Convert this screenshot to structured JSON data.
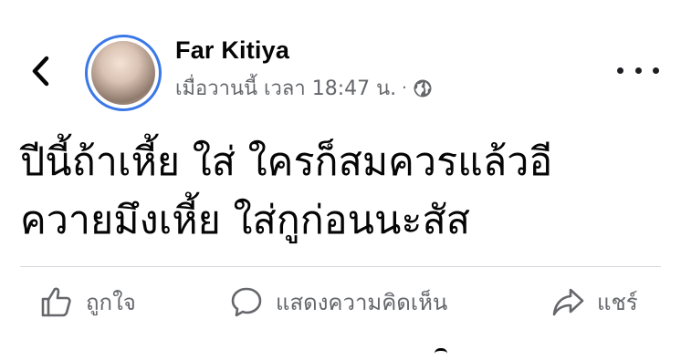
{
  "post": {
    "author": "Far Kitiya",
    "timestamp": "เมื่อวานนี้ เวลา 18:47 น.",
    "separator": "·",
    "privacy_icon": "globe-icon",
    "text_line_1": "ปีนี้ถ้าเหี้ย ใส่ ใครก็สมควรแล้วอี",
    "text_line_2": "ควายมึงเหี้ย ใส่กูก่อนนะสัส"
  },
  "actions": {
    "like_label": "ถูกใจ",
    "comment_label": "แสดงความคิดเห็น",
    "share_label": "แชร์"
  },
  "colors": {
    "avatar_ring": "#3b78e7",
    "secondary_text": "#65676b",
    "primary_text": "#050505"
  }
}
